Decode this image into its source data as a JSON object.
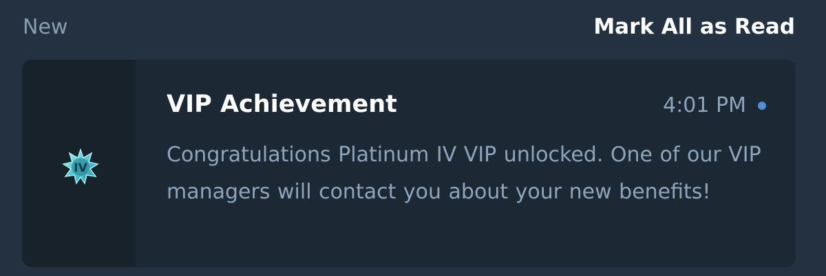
{
  "header": {
    "section_label": "New",
    "mark_all_label": "Mark All as Read"
  },
  "notification": {
    "title": "VIP Achievement",
    "time": "4:01 PM",
    "message": "Congratulations Platinum IV VIP unlocked. One of our VIP managers will contact you about your new benefits!",
    "badge_text": "IV",
    "icon": "vip-star-badge-icon",
    "unread": true,
    "colors": {
      "accent_dot": "#4f8fda",
      "badge": "#6fd6df"
    }
  }
}
